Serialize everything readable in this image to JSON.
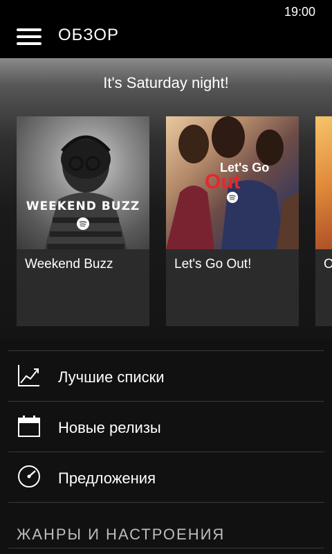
{
  "status": {
    "time": "19:00"
  },
  "header": {
    "title": "ОБЗОР"
  },
  "featured": {
    "heading": "It's Saturday night!",
    "cards": [
      {
        "label": "Weekend Buzz",
        "art_text": "WEEKEND BUZZ"
      },
      {
        "label": "Let's Go Out!",
        "art_text_top": "Let's Go",
        "art_text_bottom": "Out"
      },
      {
        "label": "O"
      }
    ]
  },
  "menu": {
    "items": [
      {
        "label": "Лучшие списки",
        "icon": "chart-icon"
      },
      {
        "label": "Новые релизы",
        "icon": "calendar-icon"
      },
      {
        "label": "Предложения",
        "icon": "discover-icon"
      }
    ]
  },
  "section": {
    "title": "ЖАНРЫ И НАСТРОЕНИЯ"
  },
  "colors": {
    "accent_green": "#1ed760",
    "accent_red": "#e8262d",
    "background": "#111111"
  }
}
